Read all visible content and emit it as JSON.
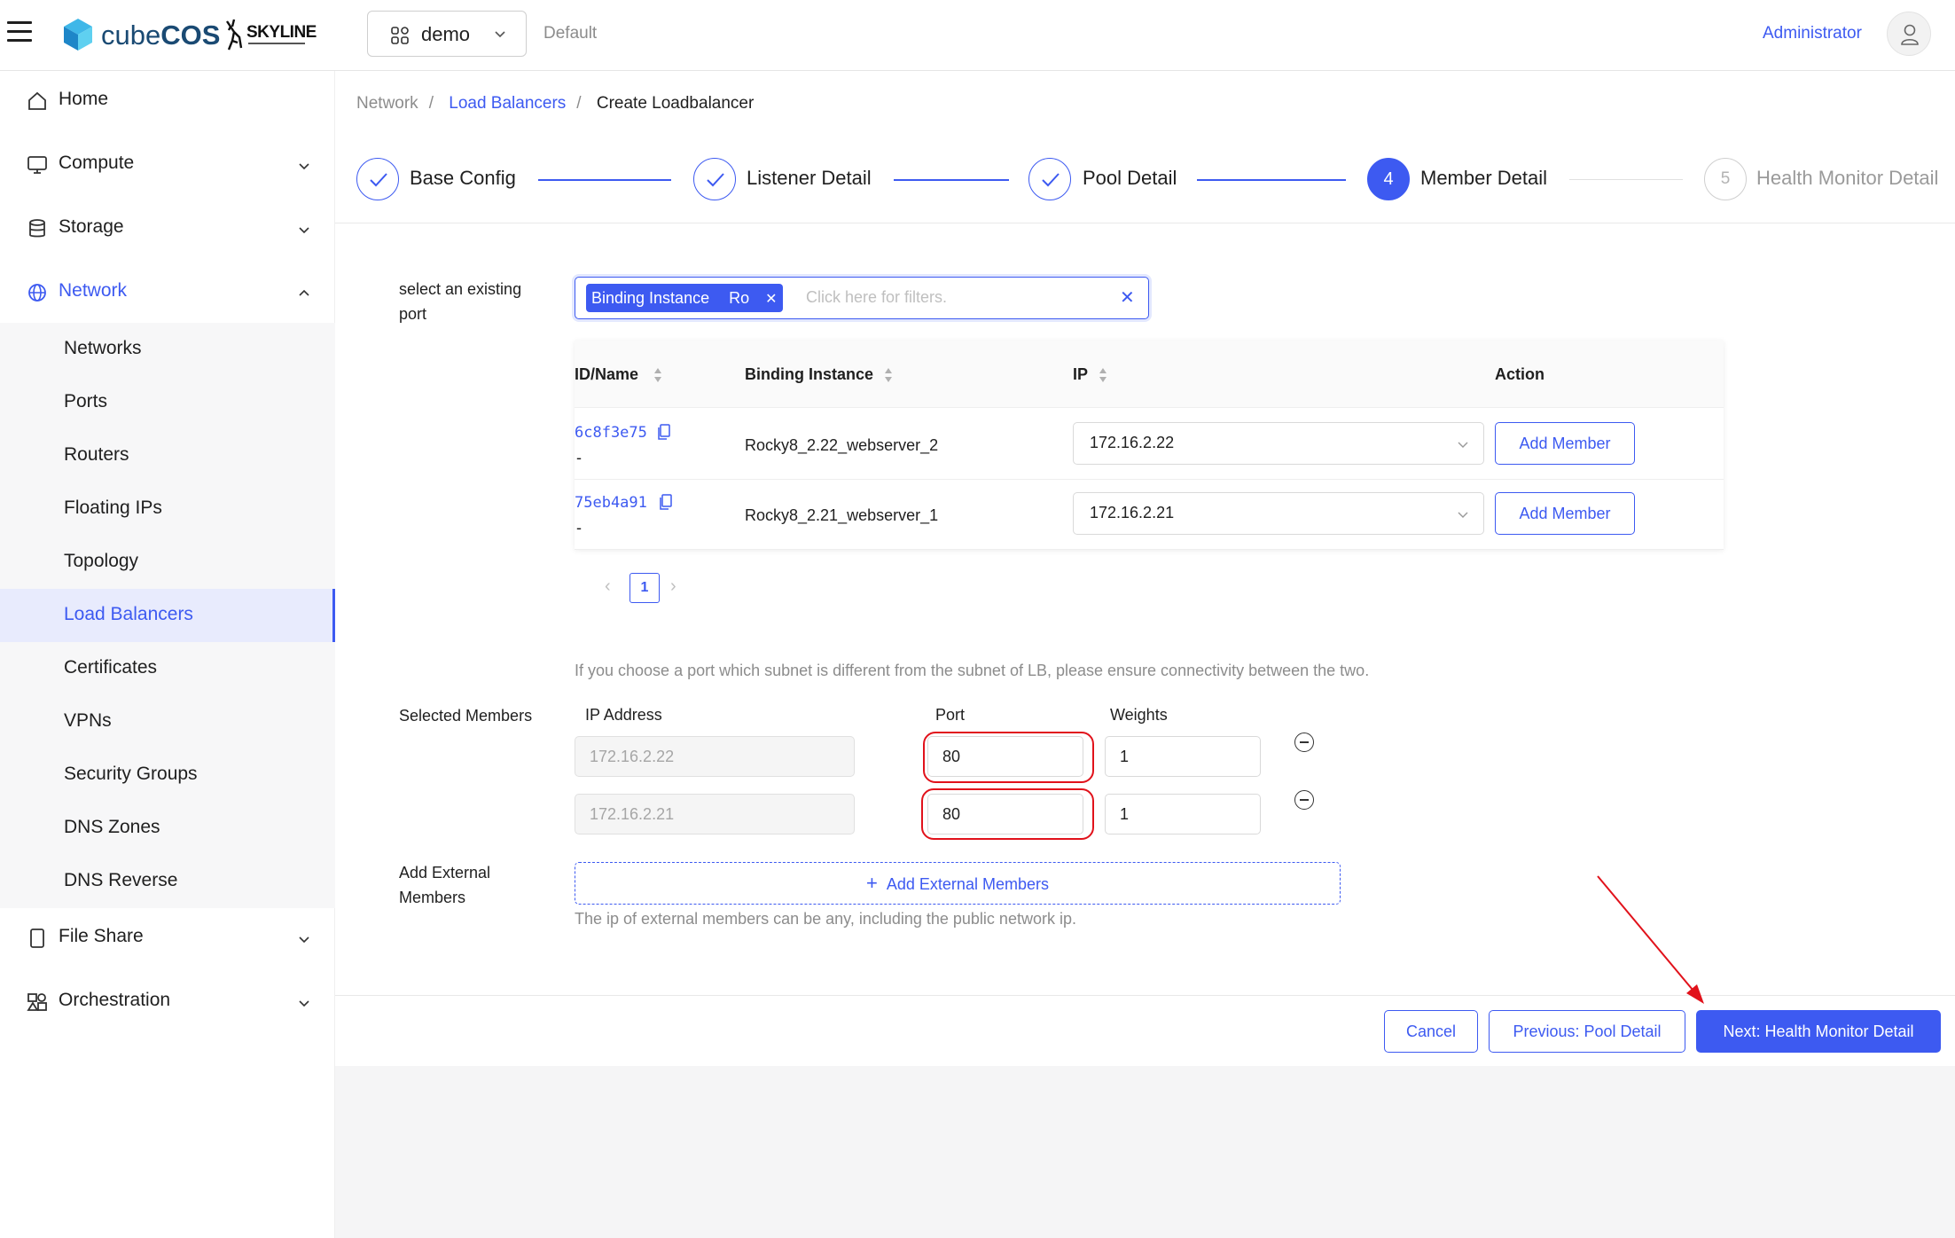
{
  "header": {
    "brand_light": "cube",
    "brand_bold": "COS",
    "partner": "SKYLINE",
    "project": "demo",
    "domain": "Default",
    "user": "Administrator"
  },
  "sidebar": {
    "top_items": [
      {
        "label": "Home",
        "icon": "home-icon"
      },
      {
        "label": "Compute",
        "icon": "monitor-icon"
      },
      {
        "label": "Storage",
        "icon": "database-icon"
      },
      {
        "label": "Network",
        "icon": "globe-icon"
      },
      {
        "label": "File Share",
        "icon": "file-icon"
      },
      {
        "label": "Orchestration",
        "icon": "orchestration-icon"
      }
    ],
    "network_items": [
      "Networks",
      "Ports",
      "Routers",
      "Floating IPs",
      "Topology",
      "Load Balancers",
      "Certificates",
      "VPNs",
      "Security Groups",
      "DNS Zones",
      "DNS Reverse"
    ],
    "active_item": "Load Balancers"
  },
  "breadcrumb": [
    "Network",
    "Load Balancers",
    "Create Loadbalancer"
  ],
  "steps": [
    {
      "label": "Base Config",
      "state": "done"
    },
    {
      "label": "Listener Detail",
      "state": "done"
    },
    {
      "label": "Pool Detail",
      "state": "done"
    },
    {
      "label": "Member Detail",
      "state": "current",
      "number": "4"
    },
    {
      "label": "Health Monitor Detail",
      "state": "pending",
      "number": "5"
    }
  ],
  "port_select": {
    "label": "select an existing port",
    "filter_tag_key": "Binding Instance",
    "filter_tag_value": "Ro",
    "placeholder": "Click here for filters."
  },
  "table": {
    "columns": [
      "ID/Name",
      "Binding Instance",
      "IP",
      "Action"
    ],
    "rows": [
      {
        "id": "6c8f3e75",
        "name": "-",
        "instance": "Rocky8_2.22_webserver_2",
        "ip": "172.16.2.22",
        "action": "Add Member"
      },
      {
        "id": "75eb4a91",
        "name": "-",
        "instance": "Rocky8_2.21_webserver_1",
        "ip": "172.16.2.21",
        "action": "Add Member"
      }
    ],
    "page": "1"
  },
  "hint_subnet": "If you choose a port which subnet is different from the subnet of LB, please ensure connectivity between the two.",
  "selected_members": {
    "label": "Selected Members",
    "col_ip": "IP Address",
    "col_port": "Port",
    "col_weight": "Weights",
    "rows": [
      {
        "ip": "172.16.2.22",
        "port": "80",
        "weight": "1"
      },
      {
        "ip": "172.16.2.21",
        "port": "80",
        "weight": "1"
      }
    ]
  },
  "external": {
    "label": "Add External Members",
    "button": "Add External Members",
    "hint": "The ip of external members can be any, including the public network ip."
  },
  "footer": {
    "cancel": "Cancel",
    "previous": "Previous: Pool Detail",
    "next": "Next: Health Monitor Detail"
  },
  "colors": {
    "accent": "#3d5af1",
    "annotation": "#e1121b"
  }
}
